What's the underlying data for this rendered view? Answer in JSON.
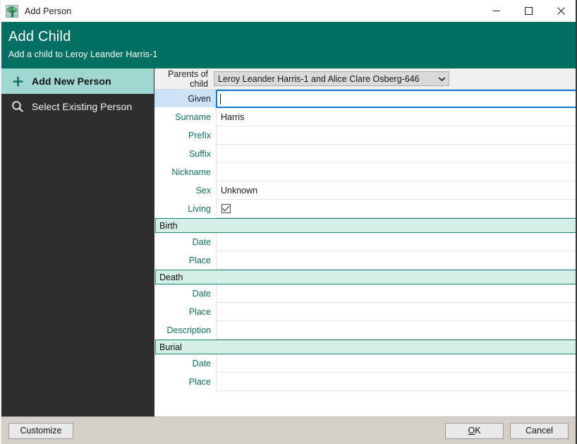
{
  "window": {
    "title": "Add Person",
    "icon": "family-tree-icon",
    "controls": {
      "minimize": "minimize-icon",
      "maximize": "maximize-icon",
      "close": "close-icon"
    }
  },
  "banner": {
    "title": "Add Child",
    "subtitle": "Add a child to Leroy Leander Harris-1",
    "background": "#017063"
  },
  "sidebar": {
    "background": "#2e2e2e",
    "active_background": "#9fd8d0",
    "items": [
      {
        "label": "Add New Person",
        "icon": "plus-icon",
        "active": true
      },
      {
        "label": "Select Existing Person",
        "icon": "search-icon",
        "active": false
      }
    ]
  },
  "parents": {
    "label": "Parents of child",
    "value": "Leroy Leander Harris-1 and Alice Clare Osberg-646",
    "arrow": "chevron-down-icon"
  },
  "form": {
    "person_fields": [
      {
        "label": "Given",
        "value": "",
        "active": true,
        "type": "text"
      },
      {
        "label": "Surname",
        "value": "Harris",
        "active": false,
        "type": "text"
      },
      {
        "label": "Prefix",
        "value": "",
        "active": false,
        "type": "text"
      },
      {
        "label": "Suffix",
        "value": "",
        "active": false,
        "type": "text"
      },
      {
        "label": "Nickname",
        "value": "",
        "active": false,
        "type": "text"
      },
      {
        "label": "Sex",
        "value": "Unknown",
        "active": false,
        "type": "text"
      },
      {
        "label": "Living",
        "value": "",
        "active": false,
        "type": "checkbox",
        "checked": true
      }
    ],
    "sections": [
      {
        "title": "Birth",
        "fields": [
          {
            "label": "Date",
            "value": ""
          },
          {
            "label": "Place",
            "value": ""
          }
        ]
      },
      {
        "title": "Death",
        "fields": [
          {
            "label": "Date",
            "value": ""
          },
          {
            "label": "Place",
            "value": ""
          },
          {
            "label": "Description",
            "value": ""
          }
        ]
      },
      {
        "title": "Burial",
        "fields": [
          {
            "label": "Date",
            "value": ""
          },
          {
            "label": "Place",
            "value": ""
          }
        ]
      }
    ]
  },
  "footer": {
    "customize_label": "Customize",
    "ok_accel": "O",
    "ok_rest": "K",
    "cancel_label": "Cancel"
  },
  "colors": {
    "teal_header": "#017063",
    "section_header": "#d5eee8",
    "section_border": "#1d8070",
    "label_teal": "#0d6f5f",
    "active_label_blue": "#cce3f7",
    "focus_border": "#0a7bd0",
    "footer_bg": "#d4d0c8"
  }
}
